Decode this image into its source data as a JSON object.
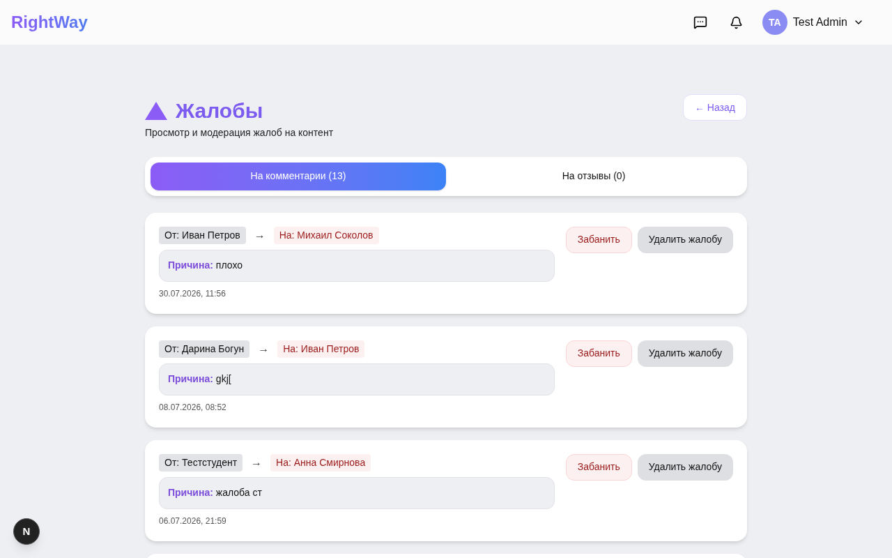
{
  "header": {
    "logo": "RightWay",
    "user": {
      "initials": "TA",
      "name": "Test Admin"
    }
  },
  "page": {
    "title": "Жалобы",
    "subtitle": "Просмотр и модерация жалоб на контент",
    "back_button": "← Назад"
  },
  "tabs": [
    {
      "label": "На комментарии (13)",
      "selected": true
    },
    {
      "label": "На отзывы (0)",
      "selected": false
    }
  ],
  "complaints": [
    {
      "from": "От: Иван Петров",
      "arrow": "→",
      "to": "На: Михаил Соколов",
      "reason_label": "Причина:",
      "reason": "плохо",
      "date": "30.07.2026, 11:56",
      "ban_button": "Забанить",
      "delete_button": "Удалить жалобу"
    },
    {
      "from": "От: Дарина Богун",
      "arrow": "→",
      "to": "На: Иван Петров",
      "reason_label": "Причина:",
      "reason": "gkj[",
      "date": "08.07.2026, 08:52",
      "ban_button": "Забанить",
      "delete_button": "Удалить жалобу"
    },
    {
      "from": "От: Тестстудент",
      "arrow": "→",
      "to": "На: Анна Смирнова",
      "reason_label": "Причина:",
      "reason": "жалоба ст",
      "date": "06.07.2026, 21:59",
      "ban_button": "Забанить",
      "delete_button": "Удалить жалобу"
    }
  ],
  "dev_badge": "N"
}
